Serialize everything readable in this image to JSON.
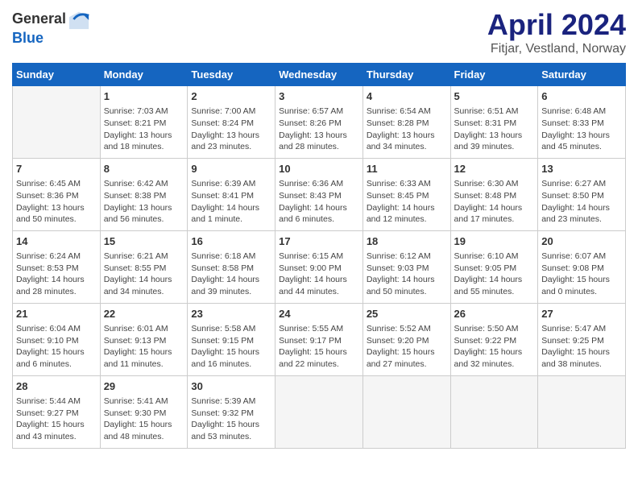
{
  "header": {
    "logo_general": "General",
    "logo_blue": "Blue",
    "month": "April 2024",
    "location": "Fitjar, Vestland, Norway"
  },
  "weekdays": [
    "Sunday",
    "Monday",
    "Tuesday",
    "Wednesday",
    "Thursday",
    "Friday",
    "Saturday"
  ],
  "weeks": [
    [
      {
        "day": "",
        "info": ""
      },
      {
        "day": "1",
        "info": "Sunrise: 7:03 AM\nSunset: 8:21 PM\nDaylight: 13 hours\nand 18 minutes."
      },
      {
        "day": "2",
        "info": "Sunrise: 7:00 AM\nSunset: 8:24 PM\nDaylight: 13 hours\nand 23 minutes."
      },
      {
        "day": "3",
        "info": "Sunrise: 6:57 AM\nSunset: 8:26 PM\nDaylight: 13 hours\nand 28 minutes."
      },
      {
        "day": "4",
        "info": "Sunrise: 6:54 AM\nSunset: 8:28 PM\nDaylight: 13 hours\nand 34 minutes."
      },
      {
        "day": "5",
        "info": "Sunrise: 6:51 AM\nSunset: 8:31 PM\nDaylight: 13 hours\nand 39 minutes."
      },
      {
        "day": "6",
        "info": "Sunrise: 6:48 AM\nSunset: 8:33 PM\nDaylight: 13 hours\nand 45 minutes."
      }
    ],
    [
      {
        "day": "7",
        "info": "Sunrise: 6:45 AM\nSunset: 8:36 PM\nDaylight: 13 hours\nand 50 minutes."
      },
      {
        "day": "8",
        "info": "Sunrise: 6:42 AM\nSunset: 8:38 PM\nDaylight: 13 hours\nand 56 minutes."
      },
      {
        "day": "9",
        "info": "Sunrise: 6:39 AM\nSunset: 8:41 PM\nDaylight: 14 hours\nand 1 minute."
      },
      {
        "day": "10",
        "info": "Sunrise: 6:36 AM\nSunset: 8:43 PM\nDaylight: 14 hours\nand 6 minutes."
      },
      {
        "day": "11",
        "info": "Sunrise: 6:33 AM\nSunset: 8:45 PM\nDaylight: 14 hours\nand 12 minutes."
      },
      {
        "day": "12",
        "info": "Sunrise: 6:30 AM\nSunset: 8:48 PM\nDaylight: 14 hours\nand 17 minutes."
      },
      {
        "day": "13",
        "info": "Sunrise: 6:27 AM\nSunset: 8:50 PM\nDaylight: 14 hours\nand 23 minutes."
      }
    ],
    [
      {
        "day": "14",
        "info": "Sunrise: 6:24 AM\nSunset: 8:53 PM\nDaylight: 14 hours\nand 28 minutes."
      },
      {
        "day": "15",
        "info": "Sunrise: 6:21 AM\nSunset: 8:55 PM\nDaylight: 14 hours\nand 34 minutes."
      },
      {
        "day": "16",
        "info": "Sunrise: 6:18 AM\nSunset: 8:58 PM\nDaylight: 14 hours\nand 39 minutes."
      },
      {
        "day": "17",
        "info": "Sunrise: 6:15 AM\nSunset: 9:00 PM\nDaylight: 14 hours\nand 44 minutes."
      },
      {
        "day": "18",
        "info": "Sunrise: 6:12 AM\nSunset: 9:03 PM\nDaylight: 14 hours\nand 50 minutes."
      },
      {
        "day": "19",
        "info": "Sunrise: 6:10 AM\nSunset: 9:05 PM\nDaylight: 14 hours\nand 55 minutes."
      },
      {
        "day": "20",
        "info": "Sunrise: 6:07 AM\nSunset: 9:08 PM\nDaylight: 15 hours\nand 0 minutes."
      }
    ],
    [
      {
        "day": "21",
        "info": "Sunrise: 6:04 AM\nSunset: 9:10 PM\nDaylight: 15 hours\nand 6 minutes."
      },
      {
        "day": "22",
        "info": "Sunrise: 6:01 AM\nSunset: 9:13 PM\nDaylight: 15 hours\nand 11 minutes."
      },
      {
        "day": "23",
        "info": "Sunrise: 5:58 AM\nSunset: 9:15 PM\nDaylight: 15 hours\nand 16 minutes."
      },
      {
        "day": "24",
        "info": "Sunrise: 5:55 AM\nSunset: 9:17 PM\nDaylight: 15 hours\nand 22 minutes."
      },
      {
        "day": "25",
        "info": "Sunrise: 5:52 AM\nSunset: 9:20 PM\nDaylight: 15 hours\nand 27 minutes."
      },
      {
        "day": "26",
        "info": "Sunrise: 5:50 AM\nSunset: 9:22 PM\nDaylight: 15 hours\nand 32 minutes."
      },
      {
        "day": "27",
        "info": "Sunrise: 5:47 AM\nSunset: 9:25 PM\nDaylight: 15 hours\nand 38 minutes."
      }
    ],
    [
      {
        "day": "28",
        "info": "Sunrise: 5:44 AM\nSunset: 9:27 PM\nDaylight: 15 hours\nand 43 minutes."
      },
      {
        "day": "29",
        "info": "Sunrise: 5:41 AM\nSunset: 9:30 PM\nDaylight: 15 hours\nand 48 minutes."
      },
      {
        "day": "30",
        "info": "Sunrise: 5:39 AM\nSunset: 9:32 PM\nDaylight: 15 hours\nand 53 minutes."
      },
      {
        "day": "",
        "info": ""
      },
      {
        "day": "",
        "info": ""
      },
      {
        "day": "",
        "info": ""
      },
      {
        "day": "",
        "info": ""
      }
    ]
  ]
}
